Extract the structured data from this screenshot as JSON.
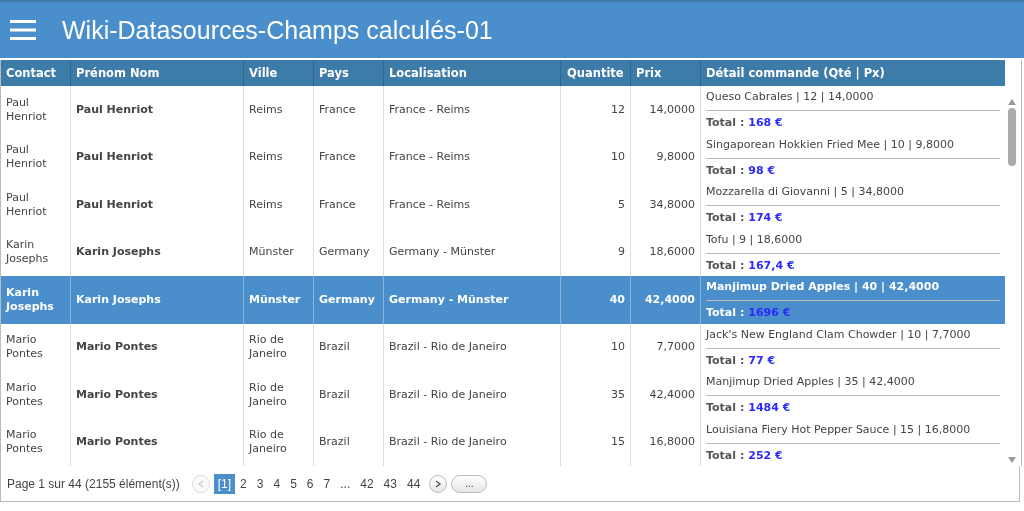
{
  "header": {
    "title": "Wiki-Datasources-Champs calculés-01"
  },
  "table": {
    "columns": [
      "Contact",
      "Prénom Nom",
      "Ville",
      "Pays",
      "Localisation",
      "Quantite",
      "Prix",
      "Détail commande (Qté | Px)"
    ],
    "rows": [
      {
        "selected": false,
        "contact": "Paul Henriot",
        "name": "Paul Henriot",
        "city": "Reims",
        "country": "France",
        "location": "France - Reims",
        "quantity": "12",
        "price": "14,0000",
        "detail": "Queso Cabrales | 12 | 14,0000",
        "total_label": "Total :",
        "total_value": "168 €"
      },
      {
        "selected": false,
        "contact": "Paul Henriot",
        "name": "Paul Henriot",
        "city": "Reims",
        "country": "France",
        "location": "France - Reims",
        "quantity": "10",
        "price": "9,8000",
        "detail": "Singaporean Hokkien Fried Mee | 10 | 9,8000",
        "total_label": "Total :",
        "total_value": "98 €"
      },
      {
        "selected": false,
        "contact": "Paul Henriot",
        "name": "Paul Henriot",
        "city": "Reims",
        "country": "France",
        "location": "France - Reims",
        "quantity": "5",
        "price": "34,8000",
        "detail": "Mozzarella di Giovanni | 5 | 34,8000",
        "total_label": "Total :",
        "total_value": "174 €"
      },
      {
        "selected": false,
        "contact": "Karin Josephs",
        "name": "Karin Josephs",
        "city": "Münster",
        "country": "Germany",
        "location": "Germany - Münster",
        "quantity": "9",
        "price": "18,6000",
        "detail": "Tofu | 9 | 18,6000",
        "total_label": "Total :",
        "total_value": "167,4 €"
      },
      {
        "selected": true,
        "contact": "Karin Josephs",
        "name": "Karin Josephs",
        "city": "Münster",
        "country": "Germany",
        "location": "Germany - Münster",
        "quantity": "40",
        "price": "42,4000",
        "detail": "Manjimup Dried Apples | 40 | 42,4000",
        "total_label": "Total :",
        "total_value": "1696 €"
      },
      {
        "selected": false,
        "contact": "Mario Pontes",
        "name": "Mario Pontes",
        "city": "Rio de Janeiro",
        "country": "Brazil",
        "location": "Brazil - Rio de Janeiro",
        "quantity": "10",
        "price": "7,7000",
        "detail": "Jack's New England Clam Chowder | 10 | 7,7000",
        "total_label": "Total :",
        "total_value": "77 €"
      },
      {
        "selected": false,
        "contact": "Mario Pontes",
        "name": "Mario Pontes",
        "city": "Rio de Janeiro",
        "country": "Brazil",
        "location": "Brazil - Rio de Janeiro",
        "quantity": "35",
        "price": "42,4000",
        "detail": "Manjimup Dried Apples | 35 | 42,4000",
        "total_label": "Total :",
        "total_value": "1484 €"
      },
      {
        "selected": false,
        "contact": "Mario Pontes",
        "name": "Mario Pontes",
        "city": "Rio de Janeiro",
        "country": "Brazil",
        "location": "Brazil - Rio de Janeiro",
        "quantity": "15",
        "price": "16,8000",
        "detail": "Louisiana Fiery Hot Pepper Sauce | 15 | 16,8000",
        "total_label": "Total :",
        "total_value": "252 €"
      }
    ]
  },
  "pager": {
    "summary": "Page 1 sur 44 (2155 élément(s))",
    "prev_disabled": true,
    "next_disabled": false,
    "pages": [
      {
        "label": "[1]",
        "selected": true
      },
      {
        "label": "2",
        "selected": false
      },
      {
        "label": "3",
        "selected": false
      },
      {
        "label": "4",
        "selected": false
      },
      {
        "label": "5",
        "selected": false
      },
      {
        "label": "6",
        "selected": false
      },
      {
        "label": "7",
        "selected": false
      },
      {
        "label": "...",
        "selected": false
      },
      {
        "label": "42",
        "selected": false
      },
      {
        "label": "43",
        "selected": false
      },
      {
        "label": "44",
        "selected": false
      }
    ],
    "more": "..."
  }
}
